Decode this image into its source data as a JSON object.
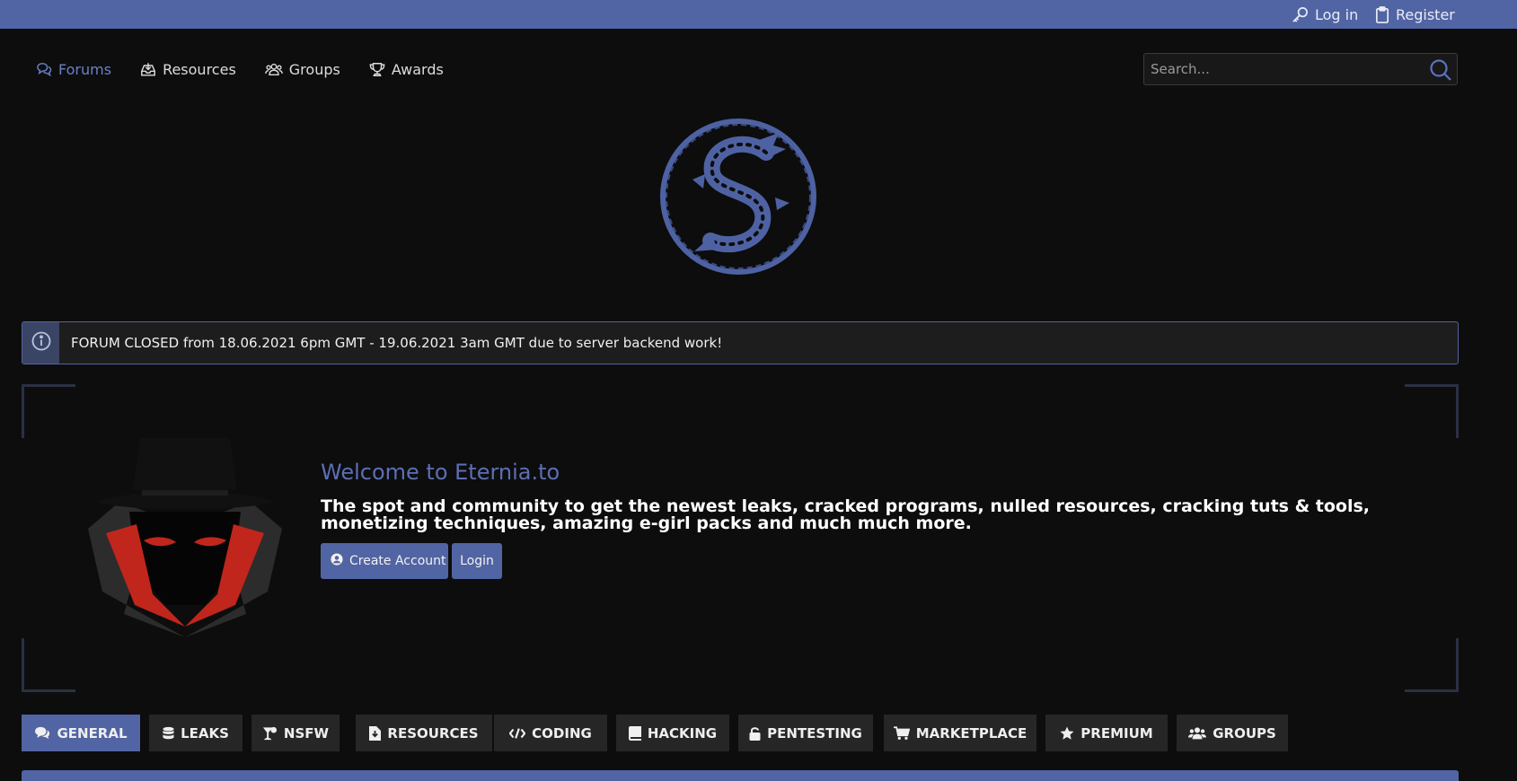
{
  "colors": {
    "accent": "#5164a3",
    "accent_light": "#6b80c7",
    "background": "#0d0d0d",
    "tab_bg": "#262626",
    "notice_bg": "#1d1d1d"
  },
  "topbar": {
    "login_label": "Log in",
    "login_icon": "key-icon",
    "register_label": "Register",
    "register_icon": "clipboard-icon"
  },
  "nav": {
    "items": [
      {
        "label": "Forums",
        "icon": "comments-icon",
        "active": true
      },
      {
        "label": "Resources",
        "icon": "inbox-download-icon",
        "active": false
      },
      {
        "label": "Groups",
        "icon": "users-icon",
        "active": false
      },
      {
        "label": "Awards",
        "icon": "trophy-icon",
        "active": false
      }
    ]
  },
  "search": {
    "placeholder": "Search...",
    "icon": "search-icon"
  },
  "logo": {
    "icon": "dragon-logo"
  },
  "notice": {
    "icon": "info-icon",
    "text": "FORUM CLOSED from 18.06.2021 6pm GMT - 19.06.2021 3am GMT due to server backend work!"
  },
  "welcome": {
    "title": "Welcome to Eternia.to",
    "text": "The spot and community to get the newest leaks, cracked programs, nulled resources, cracking tuts & tools, monetizing techniques, amazing e-girl packs and much much more.",
    "create_account_label": "Create Account",
    "create_account_icon": "user-circle-icon",
    "login_label": "Login",
    "illustration": "hacker-illustration"
  },
  "tabs": [
    {
      "label": "GENERAL",
      "icon": "comments-icon",
      "active": true
    },
    {
      "label": "LEAKS",
      "icon": "database-icon",
      "active": false
    },
    {
      "label": "NSFW",
      "icon": "cocktail-icon",
      "active": false
    },
    {
      "label": "RESOURCES",
      "icon": "file-download-icon",
      "active": false
    },
    {
      "label": "CODING",
      "icon": "code-icon",
      "active": false
    },
    {
      "label": "HACKING",
      "icon": "book-icon",
      "active": false
    },
    {
      "label": "PENTESTING",
      "icon": "lock-open-icon",
      "active": false
    },
    {
      "label": "MARKETPLACE",
      "icon": "cart-icon",
      "active": false
    },
    {
      "label": "PREMIUM",
      "icon": "star-icon",
      "active": false
    },
    {
      "label": "GROUPS",
      "icon": "users-icon",
      "active": false
    }
  ]
}
